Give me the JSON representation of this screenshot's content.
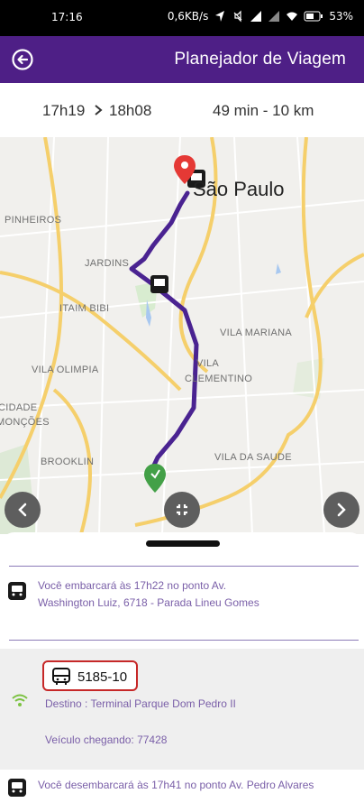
{
  "status_bar": {
    "time": "17:16",
    "net_speed": "0,6KB/s",
    "battery": "53%"
  },
  "app_bar": {
    "title": "Planejador de Viagem",
    "back_icon": "back-arrow-circle-icon"
  },
  "summary": {
    "depart_time": "17h19",
    "arrive_time": "18h08",
    "duration_distance": "49 min - 10 km"
  },
  "map": {
    "city_label": "São Paulo",
    "neighborhoods": [
      "PINHEIROS",
      "JARDINS",
      "ITAIM BIBI",
      "VILA MARIANA",
      "VILA",
      "CLEMENTINO",
      "VILA OLIMPIA",
      "CIDADE",
      "MONÇÕES",
      "BROOKLIN",
      "VILA DA SAUDE"
    ],
    "route_color": "#4a2391",
    "origin_marker_color": "#43a047",
    "destination_marker_color": "#e53935"
  },
  "steps": {
    "board_text": "Você embarcará às 17h22 no ponto Av. Washington Luiz, 6718 - Parada Lineu Gomes",
    "line_number": "5185-10",
    "destination": "Destino : Terminal Parque Dom Pedro II",
    "vehicle": "Veículo chegando: 77428",
    "alight_text": "Você desembarcará às 17h41 no ponto Av. Pedro Alvares"
  },
  "colors": {
    "primary": "#4e1f86",
    "accent_text": "#7a5fa8",
    "badge_border": "#c62828"
  }
}
